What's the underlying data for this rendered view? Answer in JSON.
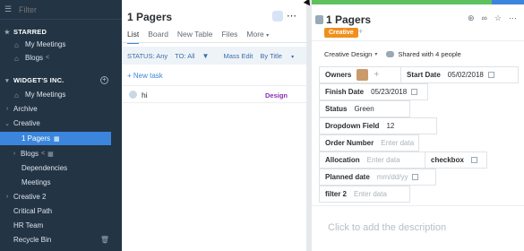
{
  "sidebar": {
    "filter_placeholder": "Filter",
    "starred_label": "STARRED",
    "starred_items": [
      {
        "label": "My Meetings"
      },
      {
        "label": "Blogs"
      }
    ],
    "workspace_label": "WIDGET'S INC.",
    "items": [
      {
        "label": "My Meetings"
      },
      {
        "label": "Archive"
      },
      {
        "label": "Creative"
      },
      {
        "label": "1 Pagers"
      },
      {
        "label": "Blogs"
      },
      {
        "label": "Dependencies"
      },
      {
        "label": "Meetings"
      },
      {
        "label": "Creative 2"
      },
      {
        "label": "Critical Path"
      },
      {
        "label": "HR Team"
      },
      {
        "label": "Recycle Bin"
      }
    ],
    "accent": "#3b86dc",
    "background": "#233445"
  },
  "list": {
    "title": "1 Pagers",
    "more_icon": "more-icon",
    "tabs": [
      "List",
      "Board",
      "New Table",
      "Files",
      "More"
    ],
    "status_label": "STATUS: Any",
    "to_label": "TO: All",
    "mass_edit": "Mass Edit",
    "sort_label": "By Title",
    "add_task": "+ New task",
    "tasks": [
      {
        "name": "hi",
        "tag": "Design"
      }
    ]
  },
  "detail": {
    "title": "1 Pagers",
    "tag": "Creative",
    "tag_plus": "+",
    "workspace": "Creative Design",
    "shared": "Shared with 4 people",
    "fields": {
      "owners": {
        "label": "Owners"
      },
      "start_date": {
        "label": "Start Date",
        "value": "05/02/2018"
      },
      "finish_date": {
        "label": "Finish Date",
        "value": "05/23/2018"
      },
      "status": {
        "label": "Status",
        "value": "Green"
      },
      "dropdown": {
        "label": "Dropdown Field",
        "value": "12"
      },
      "order_number": {
        "label": "Order Number",
        "placeholder": "Enter data"
      },
      "allocation": {
        "label": "Allocation",
        "placeholder": "Enter data"
      },
      "checkbox": {
        "label": "checkbox"
      },
      "planned_date": {
        "label": "Planned date",
        "placeholder": "mm/dd/yy"
      },
      "filter2": {
        "label": "filter 2",
        "placeholder": "Enter data"
      }
    },
    "description_placeholder": "Click to add the description",
    "tag_color": "#f08f1d",
    "bar_green": "#5fc15e"
  }
}
